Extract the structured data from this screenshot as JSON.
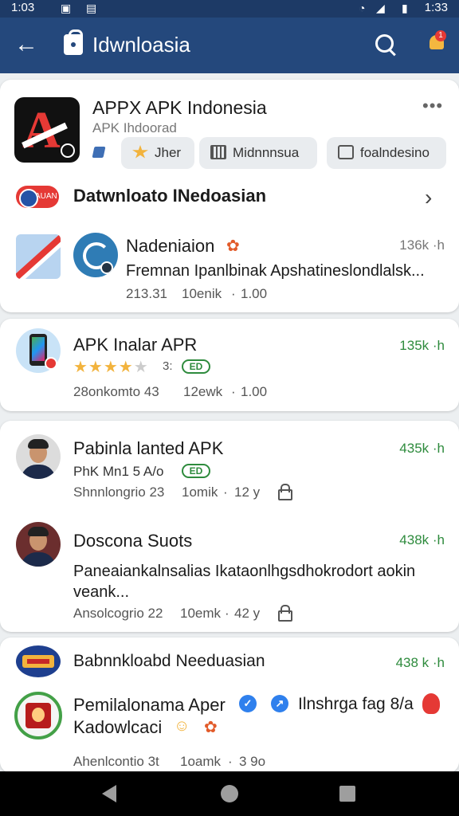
{
  "status_bar": {
    "time": "1:03",
    "right_time": "1:33"
  },
  "app_bar": {
    "title": "Idwnloasia"
  },
  "hero": {
    "title": "APPX APK Indonesia",
    "subtitle": "APK Ihdoorad",
    "more": "•••",
    "chips": [
      "Jher",
      "Midnnnsua",
      "foalndesino"
    ]
  },
  "section": {
    "title": "Datwnloato INedoasian",
    "pill": "AUAN"
  },
  "apps": [
    {
      "name": "Nadeniaion",
      "desc": "Fremnan Ipanlbinak Apshatineslondlalsk...",
      "meta1": "213.31",
      "meta2": "10enik",
      "meta3": "1.00",
      "size": "136k ·h"
    },
    {
      "name": "APK Inalar APR",
      "rating": "3:",
      "tag": "ED",
      "meta1": "28onkomto 43",
      "meta2": "12ewk",
      "meta3": "1.00",
      "size": "135k ·h"
    },
    {
      "name": "Pabinla lanted APK",
      "sub": "PhK Mn1 5 A/o",
      "tag": "ED",
      "meta1": "Shnnlongrio 23",
      "meta2": "1omik",
      "meta3": "12 y",
      "size": "435k ·h"
    },
    {
      "name": "Doscona Suots",
      "desc_line1": "Paneaiankalnsalias Ikataonlhgsdhokrodort aokin",
      "desc_line2": "veank...",
      "meta1": "Ansolcogrio 22",
      "meta2": "10emk",
      "meta3": "42 y",
      "size": "438k ·h"
    },
    {
      "name": "Babnnkloabd Needuasian",
      "size": "438 k ·h"
    },
    {
      "name": "Pemilalonama Aper",
      "tail": "Ilnshrga fag 8/a",
      "line2": "Kadowlcaci",
      "meta1": "Ahenlcontio 3t",
      "meta2": "1oamk",
      "meta3": "3 9o"
    }
  ]
}
